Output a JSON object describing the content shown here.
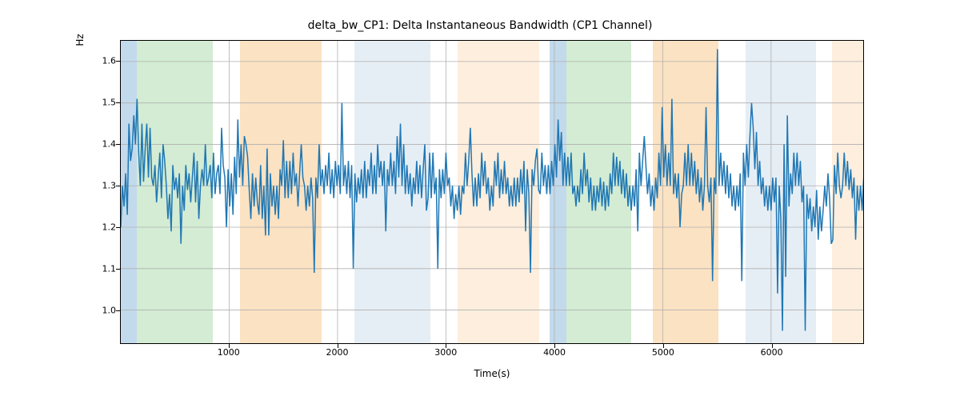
{
  "chart_data": {
    "type": "line",
    "title": "delta_bw_CP1: Delta Instantaneous Bandwidth (CP1 Channel)",
    "xlabel": "Time(s)",
    "ylabel": "Hz",
    "xlim": [
      0,
      6850
    ],
    "ylim": [
      0.92,
      1.65
    ],
    "xticks": [
      1000,
      2000,
      3000,
      4000,
      5000,
      6000
    ],
    "yticks": [
      1.0,
      1.1,
      1.2,
      1.3,
      1.4,
      1.5,
      1.6
    ],
    "bands": [
      {
        "x0": 0,
        "x1": 150,
        "color": "#9bc2e0",
        "alpha": 0.6
      },
      {
        "x0": 150,
        "x1": 850,
        "color": "#b6e0b6",
        "alpha": 0.6
      },
      {
        "x0": 1100,
        "x1": 1850,
        "color": "#f8cf9a",
        "alpha": 0.6
      },
      {
        "x0": 2150,
        "x1": 2850,
        "color": "#d6e3ef",
        "alpha": 0.6
      },
      {
        "x0": 3100,
        "x1": 3850,
        "color": "#fbe3c7",
        "alpha": 0.6
      },
      {
        "x0": 3950,
        "x1": 4100,
        "color": "#9bc2e0",
        "alpha": 0.6
      },
      {
        "x0": 4100,
        "x1": 4700,
        "color": "#b6e0b6",
        "alpha": 0.6
      },
      {
        "x0": 4900,
        "x1": 5500,
        "color": "#f8cf9a",
        "alpha": 0.6
      },
      {
        "x0": 5750,
        "x1": 6400,
        "color": "#d6e3ef",
        "alpha": 0.6
      },
      {
        "x0": 6550,
        "x1": 6850,
        "color": "#fbe3c7",
        "alpha": 0.6
      }
    ],
    "series": [
      {
        "name": "delta_bw_CP1",
        "color": "#1f77b4",
        "x_step": 15,
        "y": [
          1.2,
          1.3,
          1.25,
          1.33,
          1.23,
          1.45,
          1.36,
          1.39,
          1.47,
          1.4,
          1.51,
          1.38,
          1.3,
          1.45,
          1.31,
          1.39,
          1.45,
          1.32,
          1.44,
          1.32,
          1.3,
          1.35,
          1.26,
          1.32,
          1.38,
          1.27,
          1.4,
          1.36,
          1.3,
          1.22,
          1.28,
          1.19,
          1.35,
          1.29,
          1.32,
          1.27,
          1.33,
          1.16,
          1.3,
          1.24,
          1.35,
          1.29,
          1.33,
          1.26,
          1.32,
          1.38,
          1.26,
          1.36,
          1.22,
          1.3,
          1.34,
          1.3,
          1.4,
          1.3,
          1.32,
          1.35,
          1.27,
          1.38,
          1.28,
          1.33,
          1.35,
          1.28,
          1.44,
          1.35,
          1.32,
          1.2,
          1.34,
          1.25,
          1.33,
          1.23,
          1.37,
          1.28,
          1.46,
          1.32,
          1.4,
          1.3,
          1.42,
          1.4,
          1.37,
          1.29,
          1.22,
          1.33,
          1.25,
          1.32,
          1.26,
          1.23,
          1.35,
          1.22,
          1.3,
          1.18,
          1.39,
          1.18,
          1.33,
          1.25,
          1.3,
          1.23,
          1.3,
          1.22,
          1.34,
          1.3,
          1.41,
          1.27,
          1.36,
          1.27,
          1.36,
          1.28,
          1.38,
          1.3,
          1.33,
          1.25,
          1.33,
          1.4,
          1.32,
          1.3,
          1.24,
          1.3,
          1.25,
          1.32,
          1.27,
          1.09,
          1.32,
          1.27,
          1.4,
          1.3,
          1.34,
          1.28,
          1.35,
          1.3,
          1.38,
          1.28,
          1.34,
          1.27,
          1.36,
          1.3,
          1.35,
          1.28,
          1.5,
          1.3,
          1.35,
          1.28,
          1.36,
          1.27,
          1.35,
          1.1,
          1.33,
          1.26,
          1.32,
          1.28,
          1.34,
          1.27,
          1.36,
          1.27,
          1.34,
          1.3,
          1.38,
          1.28,
          1.35,
          1.28,
          1.4,
          1.32,
          1.36,
          1.3,
          1.36,
          1.19,
          1.34,
          1.3,
          1.38,
          1.3,
          1.36,
          1.28,
          1.42,
          1.32,
          1.45,
          1.3,
          1.4,
          1.28,
          1.35,
          1.28,
          1.33,
          1.25,
          1.32,
          1.28,
          1.36,
          1.28,
          1.35,
          1.27,
          1.34,
          1.4,
          1.24,
          1.27,
          1.38,
          1.27,
          1.38,
          1.28,
          1.32,
          1.1,
          1.34,
          1.27,
          1.34,
          1.28,
          1.38,
          1.3,
          1.32,
          1.25,
          1.3,
          1.22,
          1.28,
          1.24,
          1.3,
          1.23,
          1.3,
          1.28,
          1.38,
          1.3,
          1.36,
          1.44,
          1.33,
          1.25,
          1.32,
          1.25,
          1.33,
          1.27,
          1.38,
          1.3,
          1.36,
          1.28,
          1.32,
          1.24,
          1.3,
          1.25,
          1.36,
          1.3,
          1.38,
          1.27,
          1.34,
          1.28,
          1.36,
          1.28,
          1.32,
          1.25,
          1.3,
          1.25,
          1.32,
          1.25,
          1.32,
          1.26,
          1.34,
          1.28,
          1.36,
          1.19,
          1.34,
          1.28,
          1.09,
          1.34,
          1.3,
          1.36,
          1.39,
          1.29,
          1.28,
          1.38,
          1.3,
          1.35,
          1.28,
          1.35,
          1.28,
          1.36,
          1.3,
          1.4,
          1.32,
          1.46,
          1.36,
          1.43,
          1.3,
          1.38,
          1.3,
          1.37,
          1.3,
          1.38,
          1.28,
          1.3,
          1.25,
          1.3,
          1.26,
          1.34,
          1.28,
          1.38,
          1.3,
          1.34,
          1.26,
          1.32,
          1.24,
          1.3,
          1.24,
          1.3,
          1.26,
          1.32,
          1.25,
          1.31,
          1.24,
          1.3,
          1.25,
          1.33,
          1.28,
          1.38,
          1.3,
          1.37,
          1.3,
          1.36,
          1.28,
          1.34,
          1.27,
          1.33,
          1.25,
          1.3,
          1.24,
          1.3,
          1.25,
          1.34,
          1.19,
          1.38,
          1.3,
          1.36,
          1.42,
          1.35,
          1.28,
          1.33,
          1.25,
          1.3,
          1.24,
          1.32,
          1.27,
          1.38,
          1.3,
          1.49,
          1.32,
          1.4,
          1.3,
          1.38,
          1.3,
          1.51,
          1.28,
          1.33,
          1.27,
          1.33,
          1.2,
          1.28,
          1.3,
          1.38,
          1.3,
          1.4,
          1.3,
          1.38,
          1.3,
          1.36,
          1.28,
          1.34,
          1.26,
          1.32,
          1.24,
          1.3,
          1.49,
          1.3,
          1.26,
          1.32,
          1.07,
          1.32,
          1.28,
          1.63,
          1.3,
          1.38,
          1.3,
          1.36,
          1.28,
          1.35,
          1.27,
          1.33,
          1.25,
          1.3,
          1.24,
          1.3,
          1.25,
          1.33,
          1.07,
          1.38,
          1.3,
          1.4,
          1.32,
          1.42,
          1.5,
          1.44,
          1.34,
          1.43,
          1.3,
          1.36,
          1.28,
          1.32,
          1.25,
          1.3,
          1.24,
          1.3,
          1.24,
          1.32,
          1.26,
          1.32,
          1.04,
          1.3,
          1.22,
          0.95,
          1.4,
          1.08,
          1.47,
          1.25,
          1.33,
          1.28,
          1.38,
          1.3,
          1.38,
          1.3,
          1.36,
          1.26,
          1.3,
          0.95,
          1.28,
          1.22,
          1.27,
          1.19,
          1.25,
          1.2,
          1.29,
          1.17,
          1.25,
          1.19,
          1.24,
          1.3,
          1.25,
          1.33,
          1.27,
          1.16,
          1.17,
          1.35,
          1.28,
          1.38,
          1.3,
          1.27,
          1.3,
          1.38,
          1.3,
          1.36,
          1.29,
          1.34,
          1.27,
          1.32,
          1.17,
          1.3,
          1.24,
          1.3,
          1.24,
          1.32,
          1.26,
          1.34,
          1.28,
          1.36,
          1.28,
          1.34,
          1.27,
          1.33,
          1.26,
          1.16
        ]
      }
    ]
  }
}
